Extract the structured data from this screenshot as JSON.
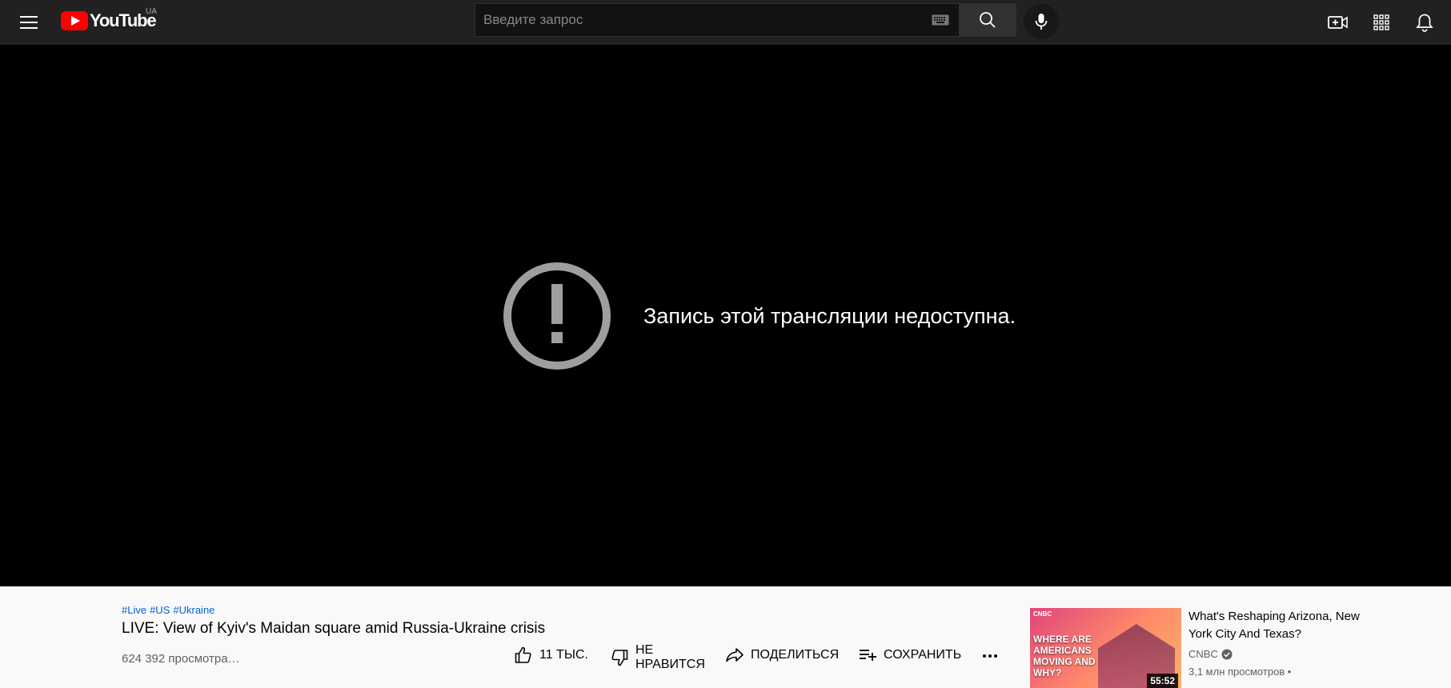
{
  "header": {
    "logo_text": "YouTube",
    "country_code": "UA",
    "search_placeholder": "Введите запрос",
    "colors": {
      "background": "#212121",
      "logo_red": "#ff0000"
    }
  },
  "player": {
    "error_message": "Запись этой трансляции недоступна.",
    "icon": "exclamation-circle-icon"
  },
  "video": {
    "hashtags": [
      "#Live",
      "#US",
      "#Ukraine"
    ],
    "title": "LIVE: View of Kyiv's Maidan square amid Russia-Ukraine crisis",
    "views": "624 392 просмотра…",
    "actions": {
      "like_count": "11 ТЫС.",
      "dislike_line1": "НЕ",
      "dislike_line2": "НРАВИТСЯ",
      "share": "ПОДЕЛИТЬСЯ",
      "save": "СОХРАНИТЬ"
    }
  },
  "suggested": [
    {
      "title": "What's Reshaping Arizona, New York City And Texas?",
      "channel": "CNBC",
      "meta": "3,1 млн просмотров •",
      "duration": "55:52",
      "thumb_brand": "CNBC",
      "thumb_text": "WHERE ARE AMERICANS MOVING AND WHY?"
    }
  ]
}
